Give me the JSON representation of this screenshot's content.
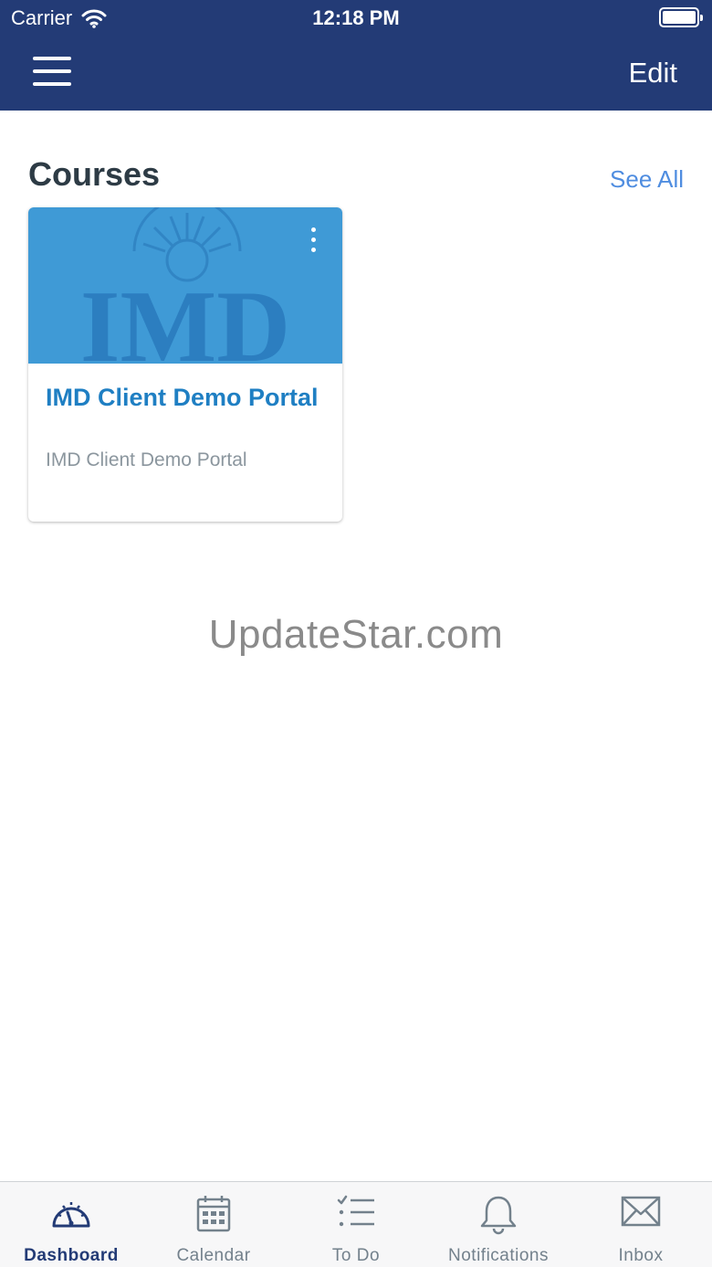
{
  "status_bar": {
    "carrier": "Carrier",
    "time": "12:18 PM"
  },
  "nav": {
    "edit_label": "Edit"
  },
  "courses": {
    "title": "Courses",
    "see_all_label": "See All"
  },
  "course_cards": [
    {
      "title": "IMD Client Demo Portal",
      "subtitle": "IMD Client Demo Portal",
      "image_text": "IMD",
      "image_color": "#3f9ad6"
    }
  ],
  "watermark": "UpdateStar.com",
  "tabs": [
    {
      "label": "Dashboard",
      "icon": "dashboard-icon",
      "active": true
    },
    {
      "label": "Calendar",
      "icon": "calendar-icon",
      "active": false
    },
    {
      "label": "To Do",
      "icon": "todo-icon",
      "active": false
    },
    {
      "label": "Notifications",
      "icon": "bell-icon",
      "active": false
    },
    {
      "label": "Inbox",
      "icon": "envelope-icon",
      "active": false
    }
  ],
  "colors": {
    "nav_bg": "#233b76",
    "link": "#4f8de0",
    "course_title": "#1f7fc3",
    "tab_active": "#233b76",
    "tab_inactive": "#73818c"
  }
}
